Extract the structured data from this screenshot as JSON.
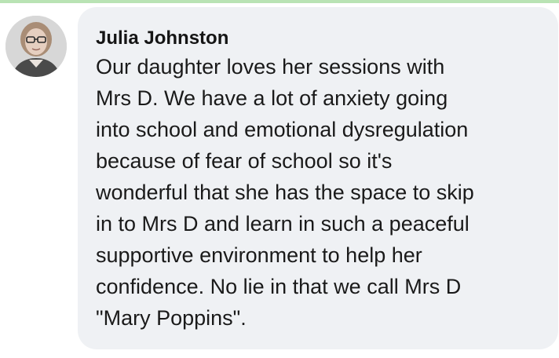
{
  "comment": {
    "author": "Julia Johnston",
    "avatar_icon": "profile-photo",
    "text": "Our daughter loves her sessions with\nMrs D.  We have a lot of anxiety going\ninto school and emotional dysregulation\nbecause of fear of school so it's\nwonderful that she has the space to skip\nin to Mrs D and learn in such a peaceful\nsupportive environment to help her\nconfidence.  No lie in that we call Mrs D\n\"Mary Poppins\"."
  },
  "colors": {
    "bubble_background": "#eff1f4",
    "text": "#1a1a1a",
    "top_accent": "#b9e3b4"
  }
}
